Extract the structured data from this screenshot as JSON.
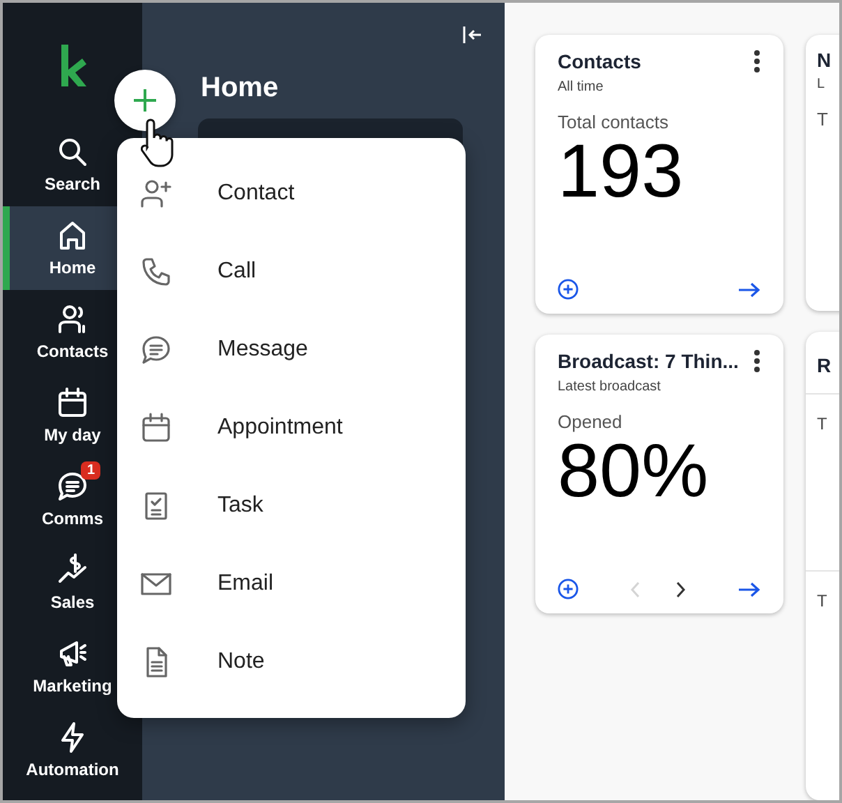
{
  "rail": {
    "items": [
      {
        "label": "Search",
        "selected": false
      },
      {
        "label": "Home",
        "selected": true
      },
      {
        "label": "Contacts",
        "selected": false
      },
      {
        "label": "My day",
        "selected": false
      },
      {
        "label": "Comms",
        "selected": false,
        "badge": "1"
      },
      {
        "label": "Sales",
        "selected": false
      },
      {
        "label": "Marketing",
        "selected": false
      },
      {
        "label": "Automation",
        "selected": false
      }
    ]
  },
  "panel": {
    "title": "Home"
  },
  "add_menu": {
    "items": [
      {
        "label": "Contact"
      },
      {
        "label": "Call"
      },
      {
        "label": "Message"
      },
      {
        "label": "Appointment"
      },
      {
        "label": "Task"
      },
      {
        "label": "Email"
      },
      {
        "label": "Note"
      }
    ]
  },
  "cards": [
    {
      "title": "Contacts",
      "subtitle": "All time",
      "metric_label": "Total contacts",
      "value": "193"
    },
    {
      "title": "Broadcast: 7 Thin...",
      "subtitle": "Latest broadcast",
      "metric_label": "Opened",
      "value": "80%",
      "pager": {
        "prev_disabled": true,
        "next_disabled": false
      }
    }
  ],
  "partial_cards": [
    {
      "title": "N",
      "subtitle": "L",
      "metric_label": "T"
    },
    {
      "title": "R",
      "rows": [
        "T",
        "T"
      ]
    }
  ]
}
